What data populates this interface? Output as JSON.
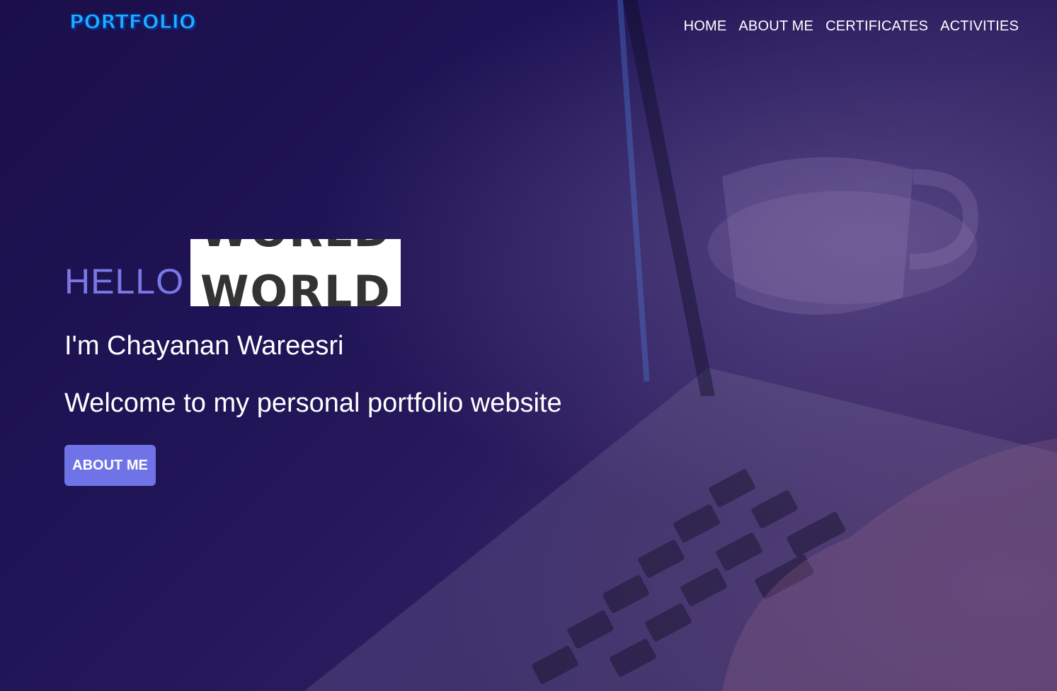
{
  "navbar": {
    "logo": "PORTFOLIO",
    "links": [
      "HOME",
      "ABOUT ME",
      "CERTIFICATES",
      "ACTIVITIES"
    ]
  },
  "hero": {
    "hello": "HELLO",
    "world_previous": "WORLD",
    "world_current": "WORLD",
    "name": "I'm Chayanan Wareesri",
    "welcome": "Welcome to my personal portfolio website",
    "button_label": "ABOUT ME"
  },
  "colors": {
    "accent": "#7073e8",
    "hello_text": "#7b78e6",
    "logo": "#1fb0ff",
    "background": "#1f1456"
  }
}
